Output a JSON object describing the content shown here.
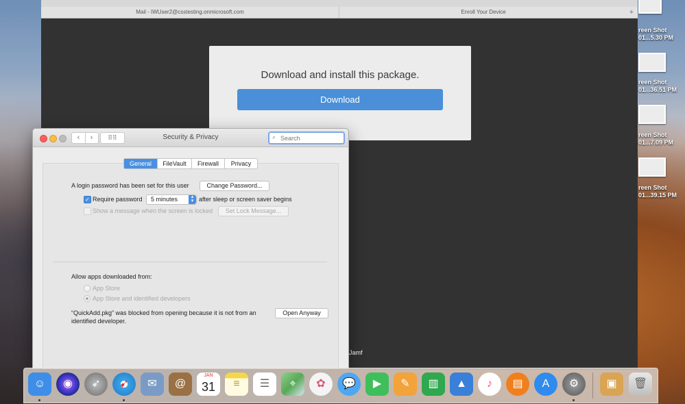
{
  "browser": {
    "tabs": [
      {
        "label": "Mail - IWUser2@csstesting.onmicrosoft.com"
      },
      {
        "label": "Enroll Your Device"
      }
    ],
    "new_tab_symbol": "+",
    "download_card": {
      "message": "Download and install this package.",
      "button_label": "Download"
    },
    "footer_text": "Jamf"
  },
  "security_window": {
    "title": "Security & Privacy",
    "search": {
      "placeholder": "Search",
      "value": ""
    },
    "nav": {
      "back": "‹",
      "forward": "›",
      "grid": "⠿⠿"
    },
    "tabs": [
      {
        "label": "General",
        "active": true
      },
      {
        "label": "FileVault",
        "active": false
      },
      {
        "label": "Firewall",
        "active": false
      },
      {
        "label": "Privacy",
        "active": false
      }
    ],
    "general": {
      "login_text": "A login password has been set for this user",
      "change_password_label": "Change Password...",
      "require_password_label": "Require password",
      "require_password_checked": true,
      "require_password_value": "5 minutes",
      "after_sleep_text": "after sleep or screen saver begins",
      "show_message_label": "Show a message when the screen is locked",
      "show_message_checked": false,
      "set_lock_message_label": "Set Lock Message...",
      "allow_apps_label": "Allow apps downloaded from:",
      "options": [
        {
          "label": "App Store",
          "selected": false
        },
        {
          "label": "App Store and identified developers",
          "selected": true
        }
      ],
      "blocked_text_line1": "“QuickAdd.pkg” was blocked from opening because it is not from an",
      "blocked_text_line2": "identified developer.",
      "open_anyway_label": "Open Anyway"
    }
  },
  "desktop": {
    "items": [
      {
        "line1": "reen Shot",
        "line2": "01...5.30 PM"
      },
      {
        "line1": "reen Shot",
        "line2": "01...36.51 PM"
      },
      {
        "line1": "reen Shot",
        "line2": "01...7.09 PM"
      },
      {
        "line1": "reen Shot",
        "line2": "01...39.15 PM"
      }
    ]
  },
  "dock": {
    "calendar_month": "JAN",
    "calendar_day": "31",
    "apps": [
      {
        "name": "Finder",
        "color": "#3e8ee8",
        "glyph": "☺"
      },
      {
        "name": "Siri",
        "color": "#6b4fd8",
        "glyph": "◉"
      },
      {
        "name": "Launchpad",
        "color": "#8c8c8c",
        "glyph": "🚀"
      },
      {
        "name": "Safari",
        "color": "#3aa3e6",
        "glyph": "◎"
      },
      {
        "name": "Mail",
        "color": "#5f7aa3",
        "glyph": "✉"
      },
      {
        "name": "Contacts",
        "color": "#9a7145",
        "glyph": "@"
      },
      {
        "name": "Calendar",
        "color": "#ffffff",
        "glyph": ""
      },
      {
        "name": "Notes",
        "color": "#f6d64a",
        "glyph": "≡"
      },
      {
        "name": "Reminders",
        "color": "#ffffff",
        "glyph": "☰"
      },
      {
        "name": "Maps",
        "color": "#6cb76a",
        "glyph": "⌖"
      },
      {
        "name": "Photos",
        "color": "#f0f0f0",
        "glyph": "✿"
      },
      {
        "name": "Messages",
        "color": "#4fa7f2",
        "glyph": "💬"
      },
      {
        "name": "FaceTime",
        "color": "#3fbf5b",
        "glyph": "▶"
      },
      {
        "name": "Pages",
        "color": "#f2a33a",
        "glyph": "✎"
      },
      {
        "name": "Numbers",
        "color": "#2fa84f",
        "glyph": "▥"
      },
      {
        "name": "Keynote",
        "color": "#3a80d9",
        "glyph": "▲"
      },
      {
        "name": "iTunes",
        "color": "#ef4b7a",
        "glyph": "♪"
      },
      {
        "name": "iBooks",
        "color": "#f07f1d",
        "glyph": "📖"
      },
      {
        "name": "App Store",
        "color": "#2f8bed",
        "glyph": "A"
      },
      {
        "name": "System Preferences",
        "color": "#7c7c7c",
        "glyph": "⚙"
      },
      {
        "name": "Package",
        "color": "#d9a453",
        "glyph": "▣"
      },
      {
        "name": "Trash",
        "color": "#d0d0d0",
        "glyph": "🗑"
      }
    ]
  }
}
